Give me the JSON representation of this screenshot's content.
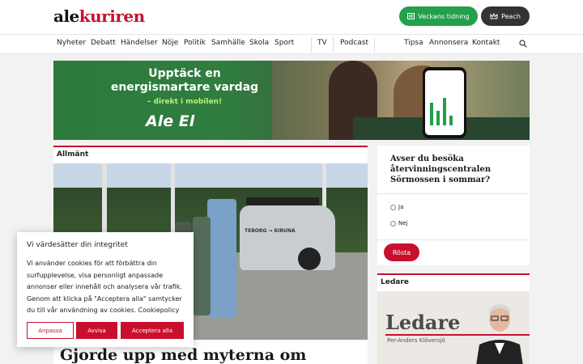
{
  "header": {
    "logo_ale": "ale",
    "logo_kuriren": "kuriren",
    "tidning_label": "Veckans tidning",
    "peach_label": "Peach"
  },
  "nav": {
    "items": [
      "Nyheter",
      "Debatt",
      "Händelser",
      "Nöje",
      "Politik",
      "Samhälle",
      "Skola",
      "Sport"
    ],
    "tv": "TV",
    "podcast": "Podcast",
    "tipsa": "Tipsa",
    "annonsera": "Annonsera",
    "kontakt": "Kontakt"
  },
  "ad": {
    "title": "Upptäck en energismartare vardag",
    "subtitle": "– direkt i mobilen!",
    "brand": "Ale El"
  },
  "article": {
    "category": "Allmänt",
    "headline": "Gjorde upp med myterna om",
    "car_text": "TEBORG → KIRUNA"
  },
  "poll": {
    "question": "Avser du besöka återvinningscentralen Sörmossen i sommar?",
    "options": [
      "Ja",
      "Nej"
    ],
    "submit": "Rösta"
  },
  "ledare": {
    "heading": "Ledare",
    "title": "Ledare",
    "author": "Per-Anders Klöversjö"
  },
  "cookie": {
    "title": "Vi värdesätter din integritet",
    "text": "Vi använder cookies för att förbättra din surfupplevelse, visa personligt anpassade annonser eller innehåll och analysera vår trafik. Genom att klicka på \"Acceptera alla\" samtycker du till vår användning av cookies.",
    "policy_link": "Cookiepolicy",
    "customize": "Anpassa",
    "reject": "Avvisa",
    "accept_all": "Acceptera alla"
  },
  "colors": {
    "brand_red": "#c8102e",
    "tidning_green": "#22a04b",
    "peach_dark": "#333333"
  }
}
